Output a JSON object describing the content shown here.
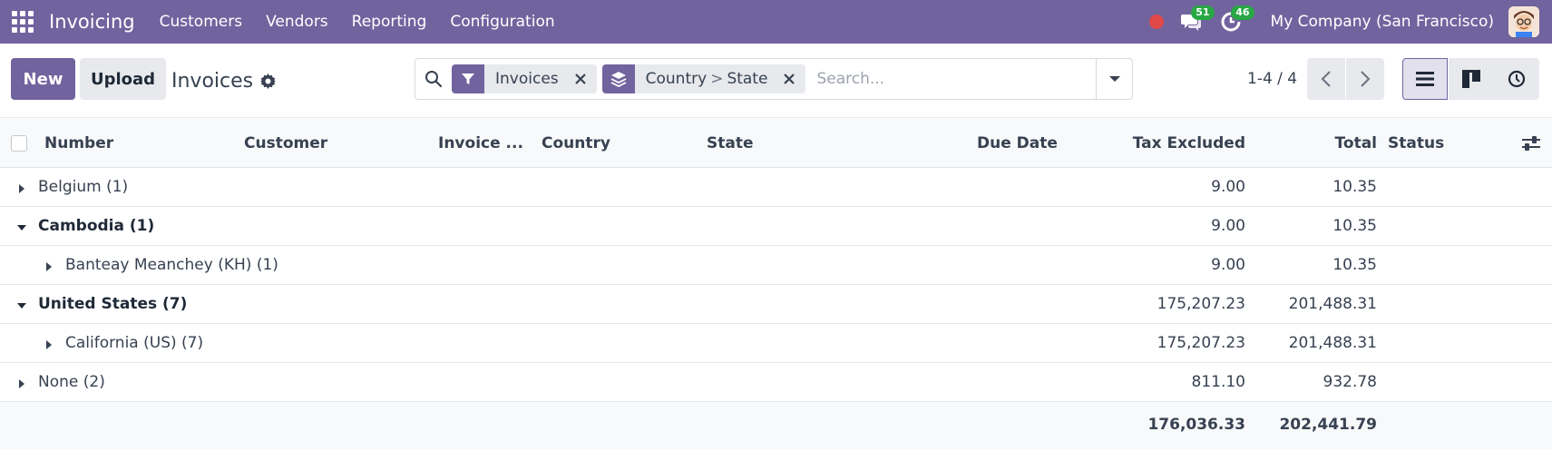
{
  "navbar": {
    "app_title": "Invoicing",
    "menu": [
      "Customers",
      "Vendors",
      "Reporting",
      "Configuration"
    ],
    "messages_count": "51",
    "activities_count": "46",
    "company": "My Company (San Francisco)"
  },
  "control": {
    "new_label": "New",
    "upload_label": "Upload",
    "title": "Invoices",
    "facets": [
      {
        "type": "filter",
        "label": "Invoices"
      },
      {
        "type": "groupby",
        "parts": [
          "Country",
          "State"
        ],
        "separator": ">"
      }
    ],
    "search_placeholder": "Search...",
    "pager": "1-4 / 4"
  },
  "table": {
    "columns": [
      "Number",
      "Customer",
      "Invoice ...",
      "Country",
      "State",
      "Due Date",
      "Tax Excluded",
      "Total",
      "Status"
    ],
    "groups": [
      {
        "label": "Belgium (1)",
        "level": 0,
        "expanded": false,
        "tax_excluded": "9.00",
        "total": "10.35"
      },
      {
        "label": "Cambodia (1)",
        "level": 0,
        "expanded": true,
        "tax_excluded": "9.00",
        "total": "10.35"
      },
      {
        "label": "Banteay Meanchey (KH) (1)",
        "level": 1,
        "expanded": false,
        "tax_excluded": "9.00",
        "total": "10.35"
      },
      {
        "label": "United States (7)",
        "level": 0,
        "expanded": true,
        "tax_excluded": "175,207.23",
        "total": "201,488.31"
      },
      {
        "label": "California (US) (7)",
        "level": 1,
        "expanded": false,
        "tax_excluded": "175,207.23",
        "total": "201,488.31"
      },
      {
        "label": "None (2)",
        "level": 0,
        "expanded": false,
        "tax_excluded": "811.10",
        "total": "932.78"
      }
    ],
    "footer": {
      "tax_excluded": "176,036.33",
      "total": "202,441.79"
    }
  },
  "colors": {
    "brand": "#71639e",
    "badge": "#28a745",
    "record": "#e04848"
  }
}
